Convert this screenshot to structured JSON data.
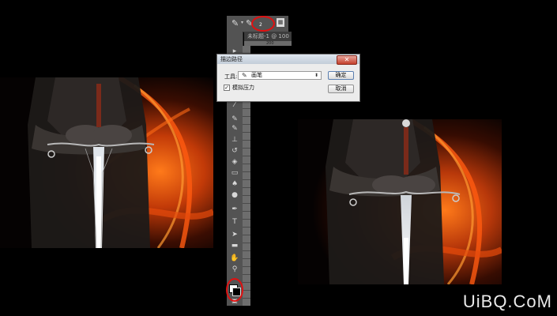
{
  "options_bar": {
    "brush_size": "2",
    "doc_tab": "未标题-1 @ 100",
    "ruler_mark": "200"
  },
  "dialog": {
    "title": "描边路径",
    "close_symbol": "✕",
    "tool_label": "工具:",
    "tool_value": "画笔",
    "ok_label": "确定",
    "cancel_label": "取消",
    "simulate_pressure_label": "模拟压力",
    "simulate_pressure_checked": true
  },
  "tools": [
    "move-icon",
    "marquee-icon",
    "lasso-icon",
    "quick-select-icon",
    "crop-icon",
    "eyedropper-icon",
    "healing-brush-icon",
    "brush-icon",
    "clone-stamp-icon",
    "history-brush-icon",
    "eraser-icon",
    "gradient-icon",
    "blur-icon",
    "dodge-icon",
    "pen-icon",
    "type-icon",
    "path-select-icon",
    "shape-icon",
    "hand-icon",
    "zoom-icon",
    "color-swatches-icon",
    "quick-mask-icon"
  ],
  "highlight_color": "#e01010",
  "watermark": "UiBQ.CoM"
}
